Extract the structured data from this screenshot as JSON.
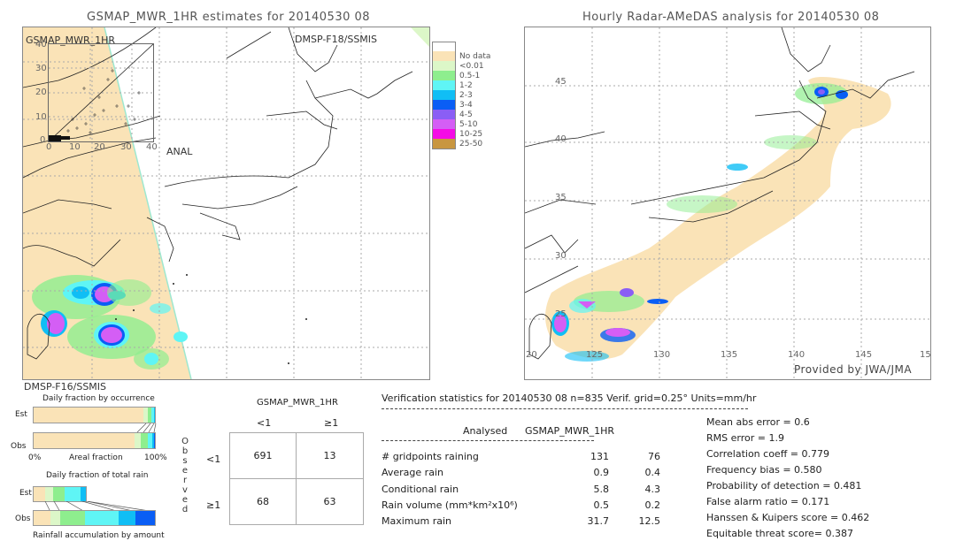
{
  "left_panel": {
    "title": "GSMAP_MWR_1HR estimates for 20140530 08",
    "map_label": "GSMAP_MWR_1HR",
    "satellite_top": "DMSP-F18/SSMIS",
    "satellite_bottom": "DMSP-F16/SSMIS",
    "inset": {
      "y_ticks": [
        "40",
        "30",
        "20",
        "10",
        "0"
      ],
      "x_ticks": [
        "0",
        "10",
        "20",
        "30",
        "40"
      ],
      "x_label": "ANAL"
    }
  },
  "legend": {
    "items": [
      {
        "label": "",
        "color": "#ffffff"
      },
      {
        "label": "No data",
        "color": "#fae3b7"
      },
      {
        "label": "<0.01",
        "color": "#dcf7c8"
      },
      {
        "label": "0.5-1",
        "color": "#8eee8e"
      },
      {
        "label": "1-2",
        "color": "#5ff5f5"
      },
      {
        "label": "2-3",
        "color": "#10bef5"
      },
      {
        "label": "3-4",
        "color": "#0a5ef5"
      },
      {
        "label": "4-5",
        "color": "#8a5ef5"
      },
      {
        "label": "5-10",
        "color": "#d45ef5"
      },
      {
        "label": "10-25",
        "color": "#f50ae6"
      },
      {
        "label": "25-50",
        "color": "#c89640"
      }
    ]
  },
  "right_panel": {
    "title": "Hourly Radar-AMeDAS analysis for 20140530 08",
    "lat_ticks": [
      "45",
      "40",
      "35",
      "30",
      "25"
    ],
    "lon_ticks": [
      "20",
      "125",
      "130",
      "135",
      "140",
      "145",
      "15"
    ],
    "credit": "Provided by JWA/JMA"
  },
  "fraction_charts": {
    "occurrence_title": "Daily fraction by occurrence",
    "est_label": "Est",
    "obs_label": "Obs",
    "axis_left": "0%",
    "axis_mid": "Areal fraction",
    "axis_right": "100%",
    "occurrence_est": [
      {
        "frac": 0.905,
        "color": "#fae3b7"
      },
      {
        "frac": 0.04,
        "color": "#dcf7c8"
      },
      {
        "frac": 0.025,
        "color": "#8eee8e"
      },
      {
        "frac": 0.02,
        "color": "#5ff5f5"
      },
      {
        "frac": 0.01,
        "color": "#10bef5"
      }
    ],
    "occurrence_obs": [
      {
        "frac": 0.835,
        "color": "#fae3b7"
      },
      {
        "frac": 0.05,
        "color": "#dcf7c8"
      },
      {
        "frac": 0.06,
        "color": "#8eee8e"
      },
      {
        "frac": 0.03,
        "color": "#5ff5f5"
      },
      {
        "frac": 0.015,
        "color": "#10bef5"
      },
      {
        "frac": 0.01,
        "color": "#0a5ef5"
      }
    ],
    "total_title": "Daily fraction of total rain",
    "total_est": [
      {
        "frac": 0.22,
        "color": "#fae3b7"
      },
      {
        "frac": 0.16,
        "color": "#dcf7c8"
      },
      {
        "frac": 0.22,
        "color": "#8eee8e"
      },
      {
        "frac": 0.3,
        "color": "#5ff5f5"
      },
      {
        "frac": 0.1,
        "color": "#10bef5"
      }
    ],
    "total_obs": [
      {
        "frac": 0.14,
        "color": "#fae3b7"
      },
      {
        "frac": 0.08,
        "color": "#dcf7c8"
      },
      {
        "frac": 0.2,
        "color": "#8eee8e"
      },
      {
        "frac": 0.28,
        "color": "#5ff5f5"
      },
      {
        "frac": 0.14,
        "color": "#10bef5"
      },
      {
        "frac": 0.16,
        "color": "#0a5ef5"
      }
    ],
    "total_footer": "Rainfall accumulation by amount"
  },
  "contingency": {
    "title": "GSMAP_MWR_1HR",
    "col_headers": [
      "<1",
      "≥1"
    ],
    "row_headers": [
      "<1",
      "≥1"
    ],
    "side_label": "Observed",
    "cells": [
      [
        "691",
        "13"
      ],
      [
        "68",
        "63"
      ]
    ]
  },
  "verification": {
    "header": "Verification statistics for 20140530 08   n=835   Verif. grid=0.25°   Units=mm/hr",
    "col_analysed": "Analysed",
    "col_model": "GSMAP_MWR_1HR",
    "rows": [
      {
        "label": "# gridpoints raining",
        "analysed": "131",
        "model": "76"
      },
      {
        "label": "Average rain",
        "analysed": "0.9",
        "model": "0.4"
      },
      {
        "label": "Conditional rain",
        "analysed": "5.8",
        "model": "4.3"
      },
      {
        "label": "Rain volume (mm*km²x10⁶)",
        "analysed": "0.5",
        "model": "0.2"
      },
      {
        "label": "Maximum rain",
        "analysed": "31.7",
        "model": "12.5"
      }
    ],
    "scores": [
      "Mean abs error = 0.6",
      "RMS error = 1.9",
      "Correlation coeff = 0.779",
      "Frequency bias = 0.580",
      "Probability of detection = 0.481",
      "False alarm ratio = 0.171",
      "Hanssen & Kuipers score = 0.462",
      "Equitable threat score= 0.387"
    ]
  }
}
